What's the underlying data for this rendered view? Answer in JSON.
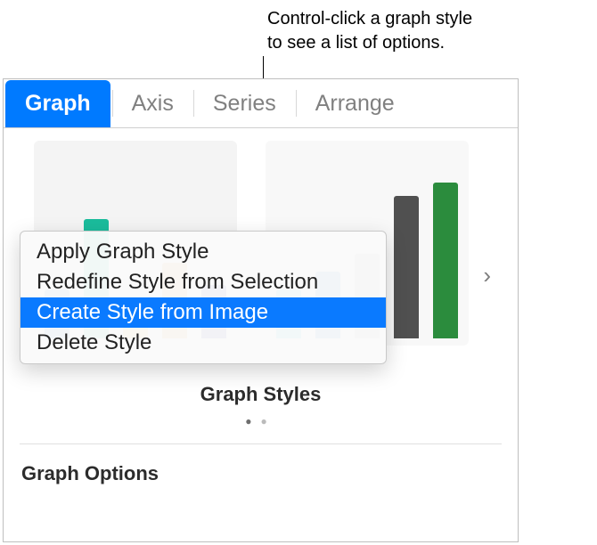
{
  "callout": "Control-click a graph style\nto see a list of options.",
  "tabs": {
    "graph": "Graph",
    "axis": "Axis",
    "series": "Series",
    "arrange": "Arrange"
  },
  "section_label": "Graph Styles",
  "options_label": "Graph Options",
  "chevron": "›",
  "menu": {
    "apply": "Apply Graph Style",
    "redefine": "Redefine Style from Selection",
    "create": "Create Style from Image",
    "delete": "Delete Style"
  }
}
